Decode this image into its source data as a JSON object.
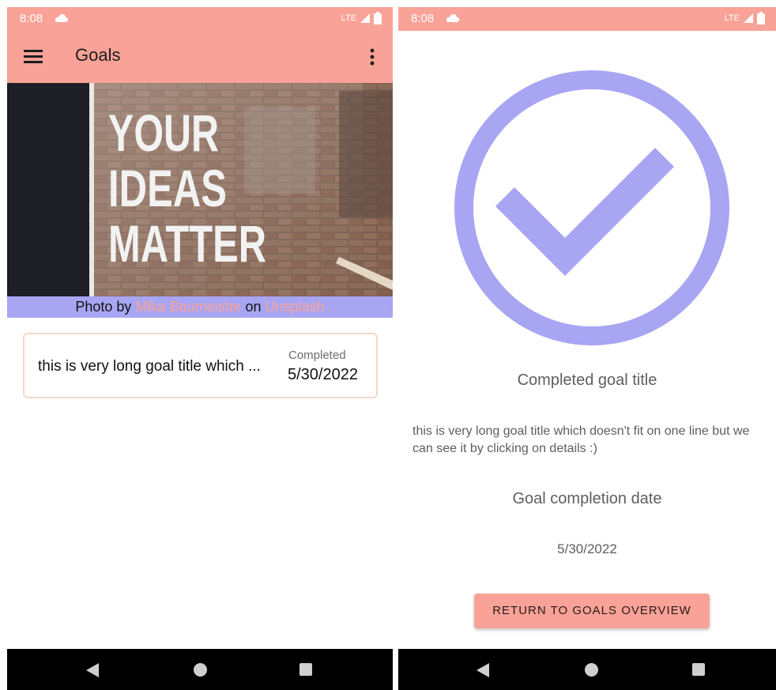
{
  "status_bar": {
    "time": "8:08",
    "network": "LTE",
    "color": "#f9a297"
  },
  "goals_screen": {
    "title": "Goals",
    "hero_image": {
      "sign_lines": [
        "YOUR",
        "IDEAS",
        "MATTER"
      ]
    },
    "credit": {
      "prefix": "Photo by",
      "author": "Mika Baumeister",
      "middle": "on",
      "source": "Unsplash"
    },
    "goal_card": {
      "title": "this is very long goal title which ...",
      "status": "Completed",
      "date": "5/30/2022"
    }
  },
  "details_screen": {
    "completed_title_label": "Completed goal title",
    "goal_title": "this is very long goal title which doesn't fit on one line but we can see it by clicking on details :)",
    "completion_date_label": "Goal completion date",
    "completion_date": "5/30/2022",
    "return_button_label": "RETURN TO GOALS OVERVIEW"
  },
  "colors": {
    "accent": "#f9a297",
    "secondary": "#a8a5f3",
    "nav_bar": "#000000"
  },
  "icons": {
    "status": [
      "cloud-icon",
      "signal-icon",
      "battery-icon"
    ],
    "app_bar": [
      "menu-icon",
      "more-vert-icon"
    ],
    "navigation": [
      "back-icon",
      "home-icon",
      "recent-apps-icon"
    ],
    "success": "check-circle-icon"
  }
}
